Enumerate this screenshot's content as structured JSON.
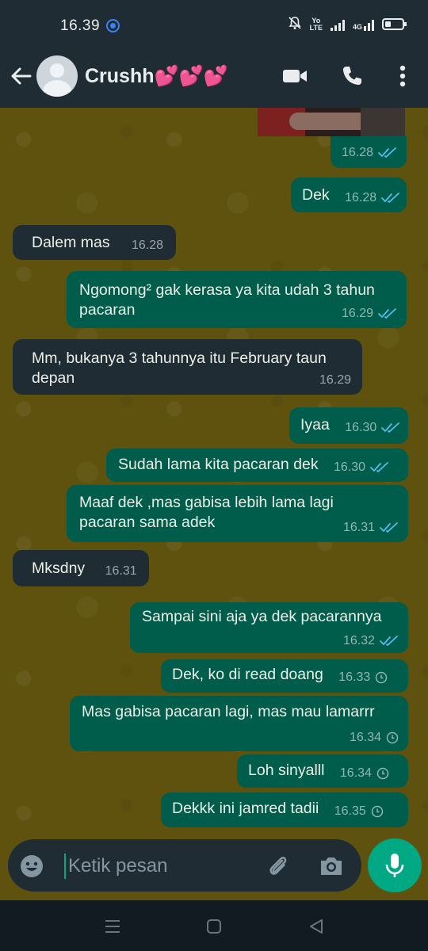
{
  "status_bar": {
    "time": "16.39",
    "network_label_top": "Yo",
    "network_label_bottom": "LTE",
    "signal_label": "4G",
    "icons": [
      "mute-icon",
      "lte-icon",
      "signal-icon",
      "4g-signal-icon",
      "battery-icon"
    ]
  },
  "header": {
    "contact_name": "Crushh💕💕💕",
    "icons": [
      "back-arrow-icon",
      "avatar-icon",
      "video-call-icon",
      "phone-call-icon",
      "more-options-icon"
    ]
  },
  "messages": [
    {
      "dir": "out",
      "text": "",
      "time": "16.28",
      "status": "read"
    },
    {
      "dir": "out",
      "text": "Dek",
      "time": "16.28",
      "status": "read"
    },
    {
      "dir": "in",
      "text": "Dalem mas",
      "time": "16.28"
    },
    {
      "dir": "out",
      "text": "Ngomong² gak kerasa ya kita udah 3 tahun pacaran",
      "time": "16.29",
      "status": "read"
    },
    {
      "dir": "in",
      "text": "Mm, bukanya 3 tahunnya itu February taun depan",
      "time": "16.29"
    },
    {
      "dir": "out",
      "text": "Iyaa",
      "time": "16.30",
      "status": "read"
    },
    {
      "dir": "out",
      "text": "Sudah lama kita pacaran dek",
      "time": "16.30",
      "status": "read"
    },
    {
      "dir": "out",
      "text": "Maaf dek ,mas gabisa lebih lama lagi pacaran sama adek",
      "time": "16.31",
      "status": "read"
    },
    {
      "dir": "in",
      "text": "Mksdny",
      "time": "16.31"
    },
    {
      "dir": "out",
      "text": "Sampai sini aja ya dek pacarannya",
      "time": "16.32",
      "status": "read"
    },
    {
      "dir": "out",
      "text": "Dek, ko di read doang",
      "time": "16.33",
      "status": "pending"
    },
    {
      "dir": "out",
      "text": "Mas gabisa pacaran lagi, mas mau lamarrr",
      "time": "16.34",
      "status": "pending"
    },
    {
      "dir": "out",
      "text": "Loh sinyalll",
      "time": "16.34",
      "status": "pending"
    },
    {
      "dir": "out",
      "text": "Dekkk ini jamred tadii",
      "time": "16.35",
      "status": "pending"
    }
  ],
  "composer": {
    "placeholder": "Ketik pesan",
    "icons": [
      "emoji-icon",
      "attach-icon",
      "camera-icon",
      "mic-icon"
    ]
  },
  "nav_bar": {
    "icons": [
      "recents-icon",
      "home-icon",
      "back-icon"
    ]
  },
  "colors": {
    "outgoing_bubble": "#005c4b",
    "incoming_bubble": "#1f2c34",
    "chat_background": "#5f520f",
    "read_tick": "#53bdeb",
    "accent": "#00a884"
  }
}
